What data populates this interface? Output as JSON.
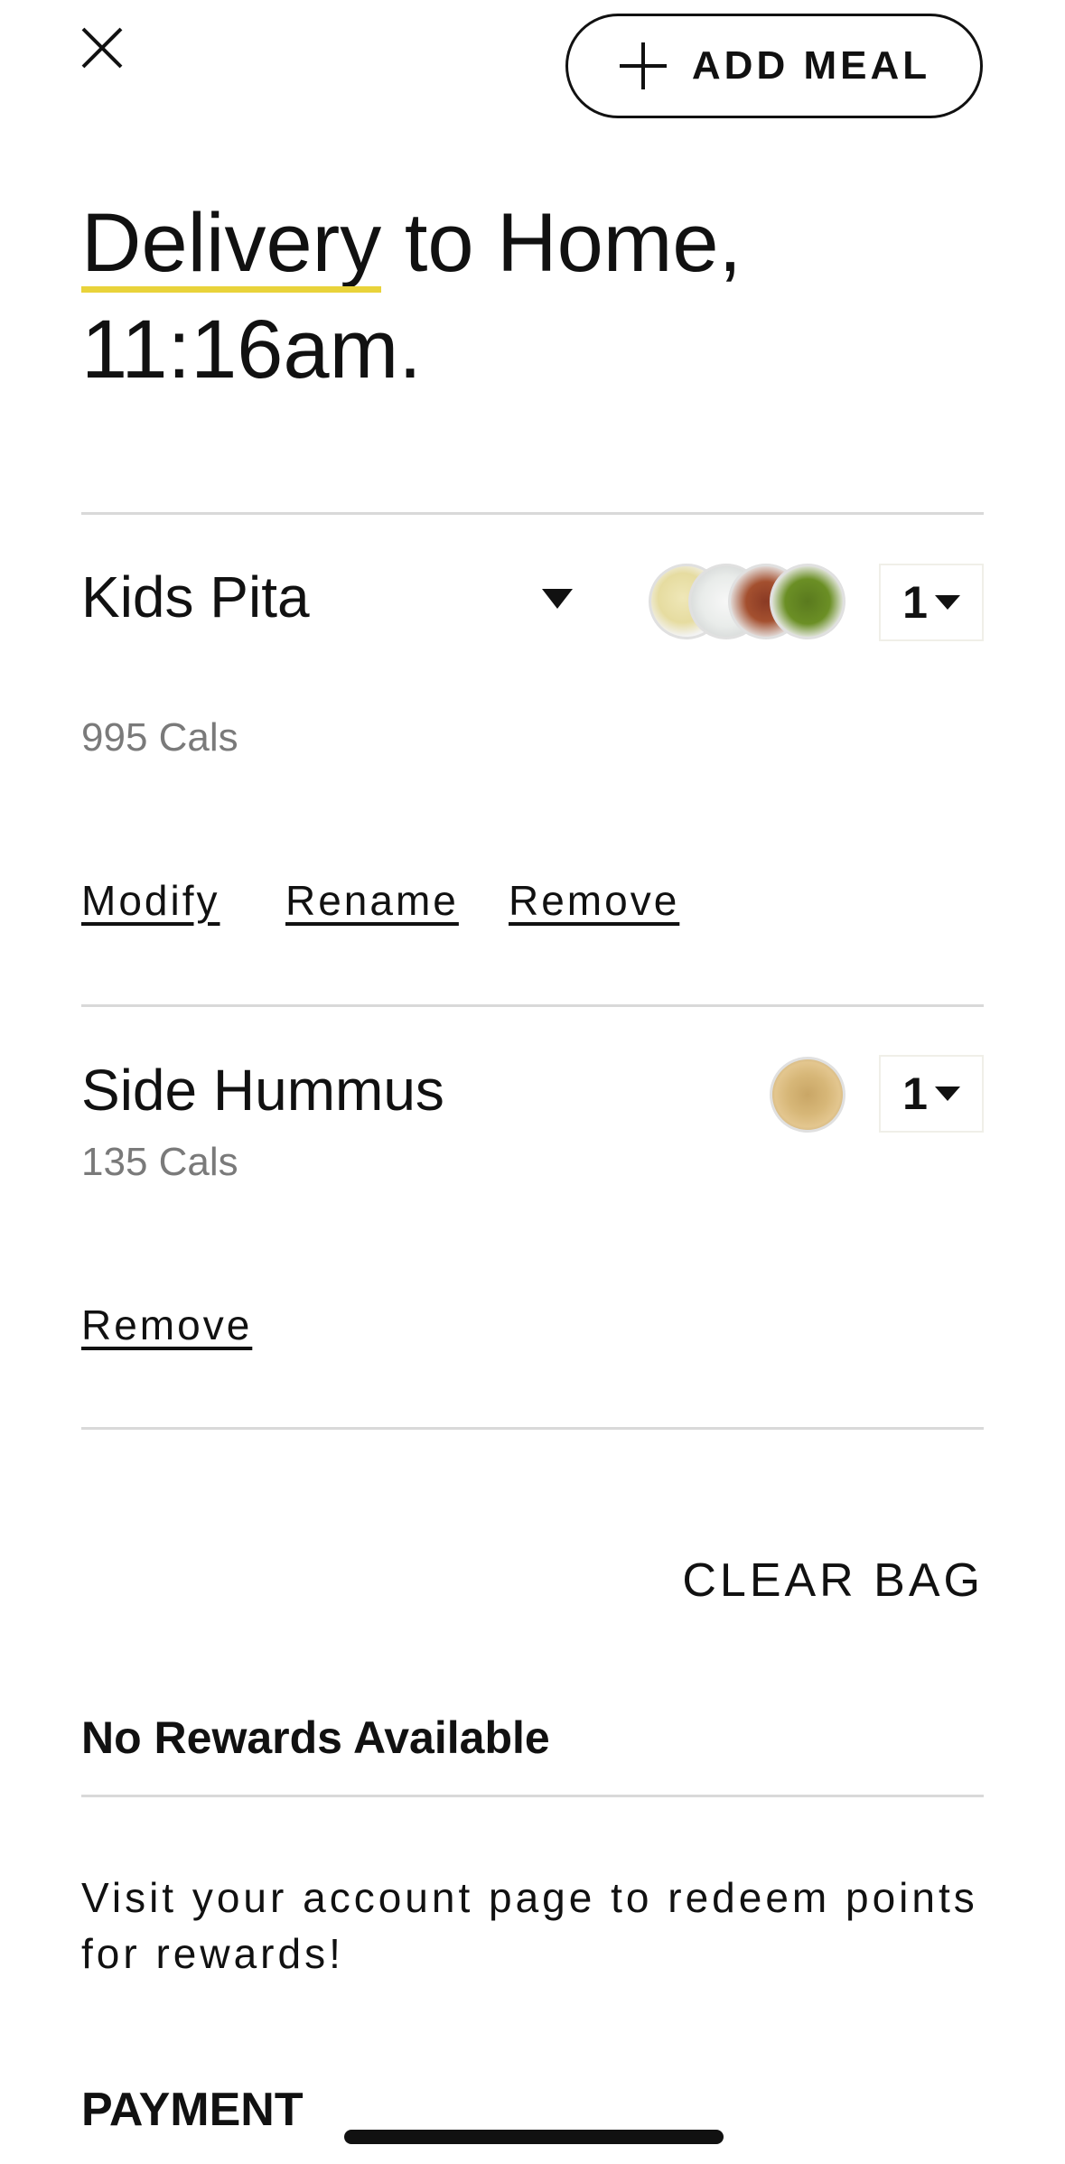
{
  "header": {
    "close_icon": "close-icon",
    "add_meal_label": "ADD MEAL",
    "add_icon": "plus-icon"
  },
  "title": {
    "method": "Delivery",
    "rest_line1": " to Home,",
    "line2": "11:16am.",
    "accent_color": "#e9d33a"
  },
  "items": [
    {
      "name": "Kids Pita",
      "cals": "995 Cals",
      "quantity": "1",
      "actions": [
        "Modify",
        "Rename",
        "Remove"
      ],
      "thumbnails": [
        "rice-icon",
        "tzatziki-icon",
        "meat-icon",
        "greens-icon"
      ]
    },
    {
      "name": "Side Hummus",
      "cals": "135 Cals",
      "quantity": "1",
      "actions": [
        "Remove"
      ],
      "thumbnails": [
        "hummus-icon"
      ]
    }
  ],
  "clear_bag_label": "CLEAR BAG",
  "rewards": {
    "heading": "No Rewards Available",
    "text": "Visit your account page to redeem points for rewards!"
  },
  "payment_label": "PAYMENT"
}
